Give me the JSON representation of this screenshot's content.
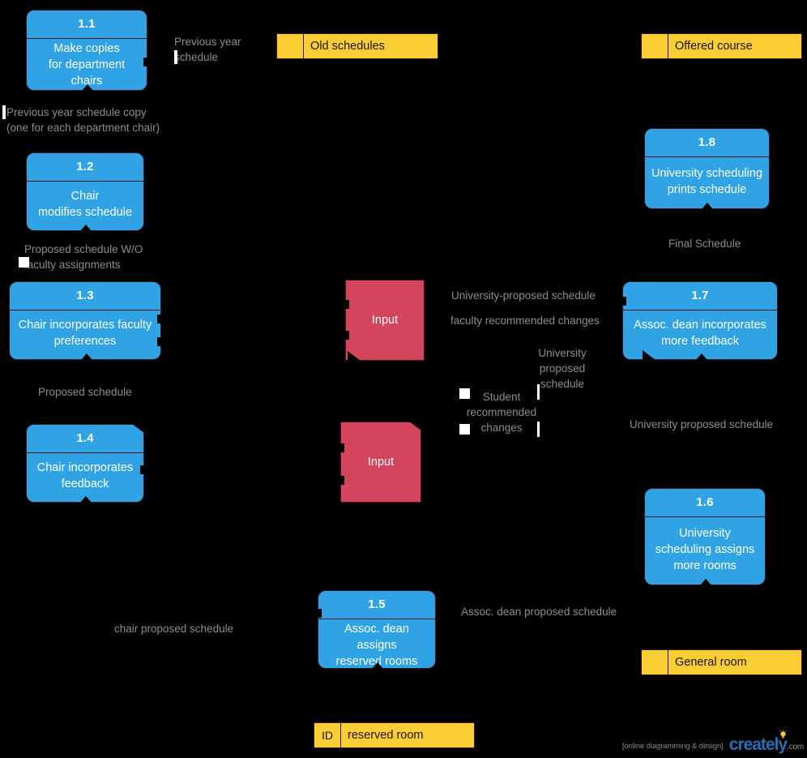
{
  "diagram": {
    "title": "Course scheduling data flow diagram",
    "background": "#000000",
    "colors": {
      "process_fill": "#2fa3e3",
      "datastore_fill": "#f9ce35",
      "entity_fill": "#d2455c",
      "shape_border": "#3d1322",
      "label_text": "#8c8c8c",
      "process_text": "#ffffff"
    }
  },
  "processes": [
    {
      "id": "1.1",
      "label": "Make copies\nfor department chairs"
    },
    {
      "id": "1.2",
      "label": "Chair\nmodifies schedule"
    },
    {
      "id": "1.3",
      "label": "Chair incorporates faculty\npreferences"
    },
    {
      "id": "1.4",
      "label": "Chair incorporates\nfeedback"
    },
    {
      "id": "1.5",
      "label": "Assoc. dean assigns\nreserved rooms"
    },
    {
      "id": "1.6",
      "label": "University\nscheduling assigns\nmore rooms"
    },
    {
      "id": "1.7",
      "label": "Assoc. dean incorporates\nmore feedback"
    },
    {
      "id": "1.8",
      "label": "University scheduling\nprints schedule"
    }
  ],
  "datastores": [
    {
      "id": "",
      "label": "Old schedules"
    },
    {
      "id": "",
      "label": "Offered course"
    },
    {
      "id": "",
      "label": "General room"
    },
    {
      "id": "ID",
      "label": "reserved room"
    }
  ],
  "entities": [
    {
      "label": "Input"
    },
    {
      "label": "Input"
    }
  ],
  "flow_labels": [
    {
      "text": "Previous year\n  schedule"
    },
    {
      "text": "Previous year schedule copy\n(one for each department chair)"
    },
    {
      "text": "Proposed schedule W/O\n  faculty assignments"
    },
    {
      "text": "Proposed schedule"
    },
    {
      "text": "chair proposed schedule"
    },
    {
      "text": "University-proposed schedule"
    },
    {
      "text": "faculty recommended changes"
    },
    {
      "text": "University\nproposed\nschedule"
    },
    {
      "text": "Student\nrecommended\nchanges"
    },
    {
      "text": "Final Schedule"
    },
    {
      "text": "University proposed schedule"
    },
    {
      "text": "Assoc. dean proposed schedule"
    }
  ],
  "watermark": {
    "tagline": "[online diagramming & design]",
    "brand": "creately",
    "tld": ".com"
  }
}
